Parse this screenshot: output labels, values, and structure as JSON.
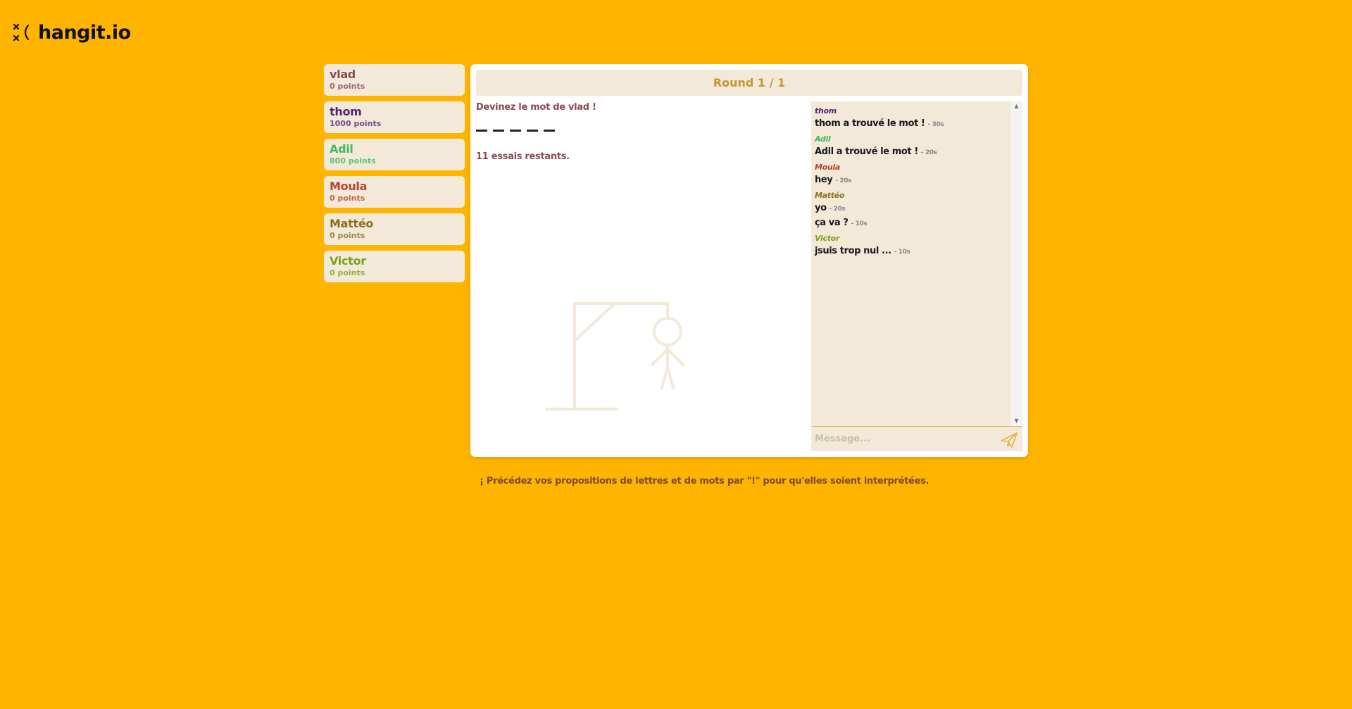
{
  "app": {
    "logo_text": "hangit.io"
  },
  "players": [
    {
      "name": "vlad",
      "points": "0 points",
      "color": "#8A4A55"
    },
    {
      "name": "thom",
      "points": "1000 points",
      "color": "#5A1E78"
    },
    {
      "name": "Adil",
      "points": "800 points",
      "color": "#3DBA5A"
    },
    {
      "name": "Moula",
      "points": "0 points",
      "color": "#B8432E"
    },
    {
      "name": "Mattéo",
      "points": "0 points",
      "color": "#8E6E1E"
    },
    {
      "name": "Victor",
      "points": "0 points",
      "color": "#7BA21E"
    }
  ],
  "game": {
    "round_label": "Round 1 / 1",
    "guess_title": "Devinez le mot de vlad !",
    "word_length": 5,
    "tries_text": "11 essais restants."
  },
  "chat": {
    "messages": [
      {
        "author": "thom",
        "color": "#5A1E78",
        "lines": [
          {
            "text": "thom a trouvé le mot !",
            "time": "- 30s"
          }
        ]
      },
      {
        "author": "Adil",
        "color": "#3DBA5A",
        "lines": [
          {
            "text": "Adil a trouvé le mot !",
            "time": "- 20s"
          }
        ]
      },
      {
        "author": "Moula",
        "color": "#B8432E",
        "lines": [
          {
            "text": "hey",
            "time": "- 20s"
          }
        ]
      },
      {
        "author": "Mattéo",
        "color": "#8E6E1E",
        "lines": [
          {
            "text": "yo",
            "time": "- 20s"
          },
          {
            "text": "ça va ?",
            "time": "- 10s"
          }
        ]
      },
      {
        "author": "Victor",
        "color": "#7BA21E",
        "lines": [
          {
            "text": "jsuis trop nul ...",
            "time": "- 10s"
          }
        ]
      }
    ],
    "input_placeholder": "Message...",
    "send_icon": "paper-plane-icon"
  },
  "footer": {
    "hint": "¡ Précédez vos propositions de lettres et de mots par \"!\" pour qu'elles soient interprétées."
  },
  "colors": {
    "background": "#FFB400",
    "card": "#F2E9D9",
    "round_text": "#C8952E"
  }
}
